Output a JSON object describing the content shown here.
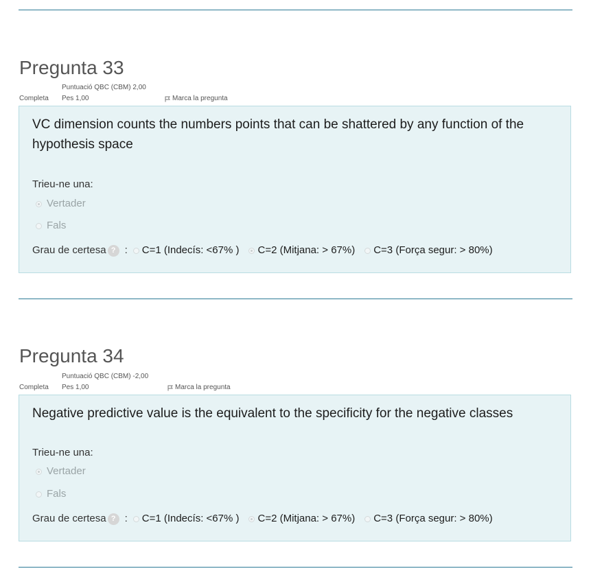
{
  "questions": [
    {
      "title": "Pregunta 33",
      "state": "Completa",
      "grade": "Puntuació QBC (CBM) 2,00",
      "weight": "Pes 1,00",
      "flag_label": "Marca la pregunta",
      "text": "VC dimension counts the numbers points that can be shattered by any function of the hypothesis space",
      "prompt": "Trieu-ne una:",
      "answers": [
        {
          "label": "Vertader",
          "selected": true
        },
        {
          "label": "Fals",
          "selected": false
        }
      ],
      "certainty_label": "Grau de certesa",
      "help_icon": "?",
      "certainty_separator": ":",
      "certainty_options": [
        {
          "label": "C=1 (Indecís: <67% )",
          "selected": false
        },
        {
          "label": "C=2 (Mitjana: > 67%)",
          "selected": true
        },
        {
          "label": "C=3 (Força segur: > 80%)",
          "selected": false
        }
      ]
    },
    {
      "title": "Pregunta 34",
      "state": "Completa",
      "grade": "Puntuació QBC (CBM) -2,00",
      "weight": "Pes 1,00",
      "flag_label": "Marca la pregunta",
      "text": "Negative predictive value is the equivalent to the specificity for the negative classes",
      "prompt": "Trieu-ne una:",
      "answers": [
        {
          "label": "Vertader",
          "selected": true
        },
        {
          "label": "Fals",
          "selected": false
        }
      ],
      "certainty_label": "Grau de certesa",
      "help_icon": "?",
      "certainty_separator": ":",
      "certainty_options": [
        {
          "label": "C=1 (Indecís: <67% )",
          "selected": false
        },
        {
          "label": "C=2 (Mitjana: > 67%)",
          "selected": true
        },
        {
          "label": "C=3 (Força segur: > 80%)",
          "selected": false
        }
      ]
    }
  ],
  "colors": {
    "divider": "#2c7a96",
    "question_box": "#e7f3f5",
    "question_box_border": "#b8dce2"
  }
}
